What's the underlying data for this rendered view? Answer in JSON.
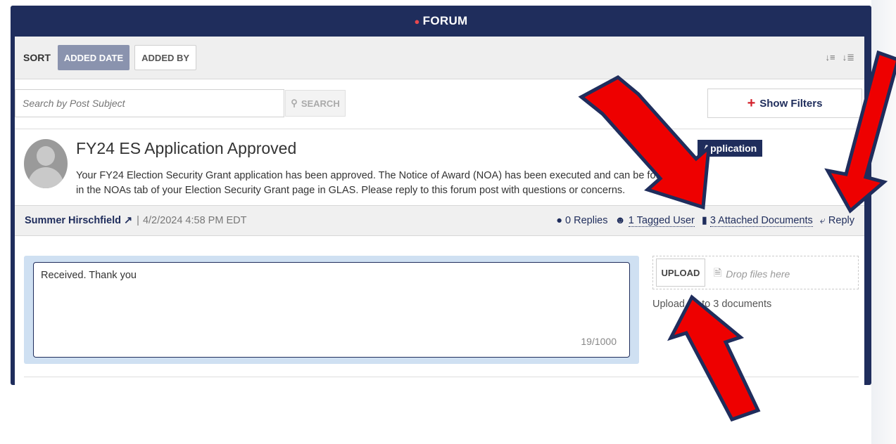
{
  "window": {
    "title": "FORUM"
  },
  "sort": {
    "label": "SORT",
    "options": [
      "ADDED DATE",
      "ADDED BY"
    ],
    "active": "ADDED DATE"
  },
  "search": {
    "placeholder": "Search by Post Subject",
    "button_label": "SEARCH"
  },
  "filters": {
    "button_label": "Show Filters"
  },
  "post": {
    "title": "FY24 ES Application Approved",
    "body": "Your FY24 Election Security Grant application has been approved. The Notice of Award (NOA) has been executed and can be found in the NOAs tab of your Election Security Grant page in GLAS. Please reply to this forum post with questions or concerns.",
    "tag": "Application",
    "author": "Summer Hirschfield ↗",
    "separator": "|",
    "date": "4/2/2024 4:58 PM EDT",
    "replies": "0 Replies",
    "tagged_users": "1 Tagged User",
    "attached_documents": "3 Attached Documents",
    "reply_label": "Reply"
  },
  "reply_form": {
    "value": "Received. Thank you",
    "counter": "19/1000",
    "upload_label": "UPLOAD",
    "drop_text": "Drop files here",
    "upload_note": "Upload up to 3 documents"
  },
  "colors": {
    "navy": "#1f2d5c",
    "accent_red": "#e8484d",
    "annotation_red": "#ee0000",
    "sort_active": "#8a93ae",
    "reply_bg": "#cfe0f2"
  },
  "icons": [
    "chat-icon",
    "sort-asc-icon",
    "sort-desc-icon",
    "search-icon",
    "plus-icon",
    "comment-icon",
    "user-icon",
    "documents-icon",
    "reply-icon",
    "file-cursor-icon"
  ]
}
